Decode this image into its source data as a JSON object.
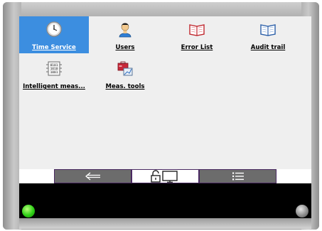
{
  "icons": [
    {
      "label": "Time Service",
      "icon": "clock-icon",
      "selected": true
    },
    {
      "label": "Users",
      "icon": "user-icon",
      "selected": false
    },
    {
      "label": "Error List",
      "icon": "open-book-red-icon",
      "selected": false
    },
    {
      "label": "Audit trail",
      "icon": "open-book-blue-icon",
      "selected": false
    },
    {
      "label": "Intelligent meas...",
      "icon": "binary-data-icon",
      "selected": false
    },
    {
      "label": "Meas. tools",
      "icon": "toolbox-icon",
      "selected": false
    }
  ],
  "navbar": {
    "buttons": [
      {
        "icon": "back-arrow-icon",
        "active": false
      },
      {
        "icon": "lock-screen-icon",
        "active": true
      },
      {
        "icon": "list-icon",
        "active": false
      }
    ]
  },
  "leds": {
    "left": {
      "color": "#2ecf16",
      "state": "on"
    },
    "right": {
      "color": "#8e8e8e",
      "state": "off"
    }
  },
  "colors": {
    "selection": "#3c8ee0",
    "nav_button": "#6c6c6c",
    "nav_border": "#4a2a62"
  }
}
